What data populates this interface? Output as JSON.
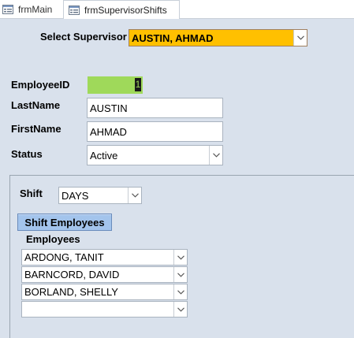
{
  "tabs": [
    {
      "label": "frmMain"
    },
    {
      "label": "frmSupervisorShifts"
    }
  ],
  "supervisor": {
    "label": "Select Supervisor",
    "value": "AUSTIN, AHMAD"
  },
  "employee": {
    "id_label": "EmployeeID",
    "id_value": "1",
    "lastname_label": "LastName",
    "lastname_value": "AUSTIN",
    "firstname_label": "FirstName",
    "firstname_value": "AHMAD",
    "status_label": "Status",
    "status_value": "Active"
  },
  "shift": {
    "label": "Shift",
    "value": "DAYS",
    "button_label": "Shift Employees",
    "employees_label": "Employees",
    "employees": [
      {
        "name": "ARDONG, TANIT"
      },
      {
        "name": "BARNCORD, DAVID"
      },
      {
        "name": "BORLAND, SHELLY"
      },
      {
        "name": ""
      }
    ]
  },
  "colors": {
    "supervisor_bg": "#ffc000",
    "id_bg": "#9fd95a",
    "button_bg": "#a3c4ec",
    "form_bg": "#d9e1ec"
  },
  "icons": [
    "form-icon",
    "chevron-down-icon"
  ]
}
